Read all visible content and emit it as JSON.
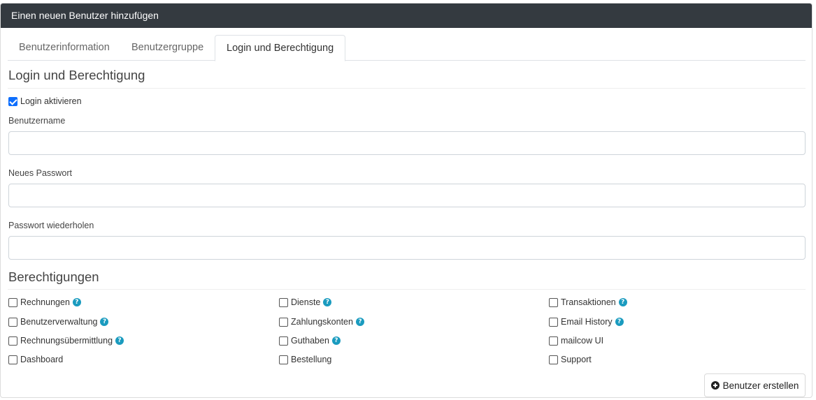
{
  "dialog": {
    "title": "Einen neuen Benutzer hinzufügen"
  },
  "tabs": [
    {
      "label": "Benutzerinformation"
    },
    {
      "label": "Benutzergruppe"
    },
    {
      "label": "Login und Berechtigung",
      "active": true
    }
  ],
  "login": {
    "section_title": "Login und Berechtigung",
    "enable_label": "Login aktivieren",
    "enable_checked": true,
    "username_label": "Benutzername",
    "username_value": "",
    "password_label": "Neues Passwort",
    "password_value": "",
    "repeat_label": "Passwort wiederholen",
    "repeat_value": ""
  },
  "permissions": {
    "section_title": "Berechtigungen",
    "items": [
      {
        "label": "Rechnungen",
        "help": true,
        "checked": false
      },
      {
        "label": "Dienste",
        "help": true,
        "checked": false
      },
      {
        "label": "Transaktionen",
        "help": true,
        "checked": false
      },
      {
        "label": "Benutzerverwaltung",
        "help": true,
        "checked": false
      },
      {
        "label": "Zahlungskonten",
        "help": true,
        "checked": false
      },
      {
        "label": "Email History",
        "help": true,
        "checked": false
      },
      {
        "label": "Rechnungsübermittlung",
        "help": true,
        "checked": false
      },
      {
        "label": "Guthaben",
        "help": true,
        "checked": false
      },
      {
        "label": "mailcow UI",
        "help": false,
        "checked": false
      },
      {
        "label": "Dashboard",
        "help": false,
        "checked": false
      },
      {
        "label": "Bestellung",
        "help": false,
        "checked": false
      },
      {
        "label": "Support",
        "help": false,
        "checked": false
      }
    ]
  },
  "actions": {
    "create_label": "Benutzer erstellen",
    "create_icon": "plus-circle-icon"
  },
  "colors": {
    "header_bg": "#343a40",
    "accent": "#0d6efd",
    "help": "#1a9bbf"
  }
}
